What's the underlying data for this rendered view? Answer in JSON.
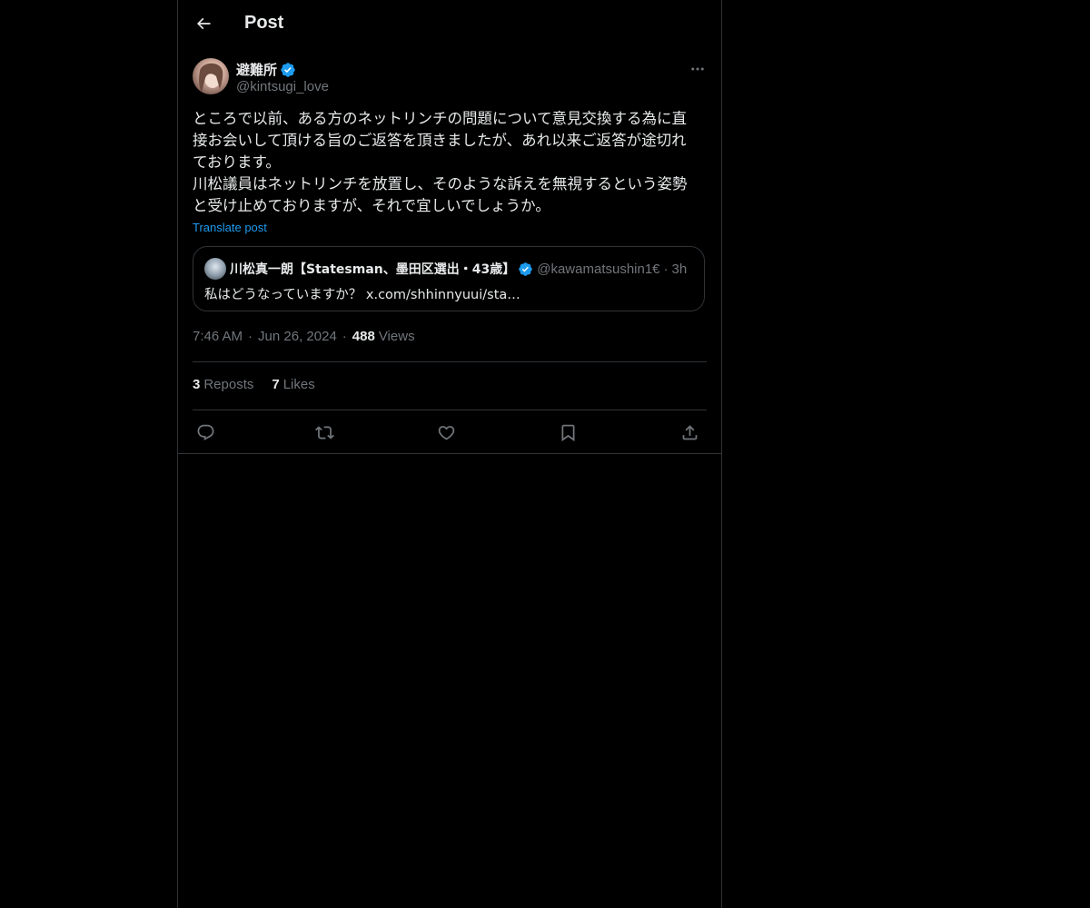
{
  "header": {
    "title": "Post",
    "back_icon": "arrow-left-icon"
  },
  "post": {
    "author_name": "避難所",
    "author_handle": "@kintsugi_love",
    "verified": true,
    "body": "ところで以前、ある方のネットリンチの問題について意見交換する為に直\n接お会いして頂ける旨のご返答を頂きましたが、あれ以来ご返答が途切れ\nております。\n川松議員はネットリンチを放置し、そのような訴えを無視するという姿勢\nと受け止めておりますが、それで宜しいでしょうか。",
    "translate_label": "Translate post",
    "time": "7:46 AM",
    "date": "Jun 26, 2024",
    "views_count": "488",
    "views_label": "Views",
    "separator": "·"
  },
  "quote": {
    "author_name": "川松真一朗【Statesman、墨田区選出・43歳】",
    "author_handle": "@kawamatsushin1€",
    "verified": true,
    "separator": "·",
    "time": "3h",
    "text": "私はどうなっていますか？ x.com/shhinnyuui/sta…"
  },
  "stats": {
    "reposts_count": "3",
    "reposts_label": "Reposts",
    "likes_count": "7",
    "likes_label": "Likes"
  },
  "actions": [
    "reply-icon",
    "repost-icon",
    "like-icon",
    "bookmark-icon",
    "share-icon"
  ],
  "colors": {
    "background": "#000000",
    "text": "#e7e9ea",
    "secondary": "#71767b",
    "accent": "#1d9bf0",
    "border": "#2f3336"
  }
}
